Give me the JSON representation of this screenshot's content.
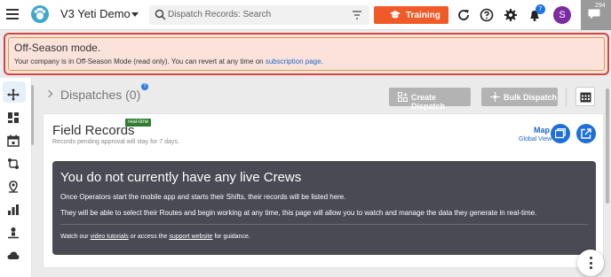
{
  "header": {
    "app_title": "V3 Yeti Demo",
    "search_placeholder": "Dispatch Records: Search",
    "training_label": "Training",
    "notification_count": "7",
    "avatar_initial": "S",
    "chat_count": "294",
    "accent_color": "#f05a28"
  },
  "banner": {
    "title": "Off-Season mode.",
    "text": "Your company is in Off-Season Mode (read only). You can revert at any time on",
    "link_text": "subscription page",
    "suffix": "."
  },
  "dispatches": {
    "title": "Dispatches (0)",
    "create_label": "Create Dispatch",
    "bulk_label": "Bulk Dispatch"
  },
  "field_records": {
    "title": "Field Records",
    "badge": "real-time",
    "subtitle": "Records pending approval will stay for 7 days.",
    "map_label": "Map",
    "map_sub": "Global View"
  },
  "empty_state": {
    "title": "You do not currently have any live Crews",
    "para1": "Once Operators start the mobile app and starts their Shifts, their records will be listed here.",
    "para2": "They will be able to select their Routes and begin working at any time, this page will allow you to watch and manage the data they generate in real-time.",
    "foot_prefix": "Watch our",
    "foot_link1": "video tutorials",
    "foot_mid": "or access the",
    "foot_link2": "support website",
    "foot_suffix": "for guidance."
  },
  "icons": [
    "menu-icon",
    "paw-logo-icon",
    "search-icon",
    "filter-icon",
    "graduation-cap-icon",
    "refresh-icon",
    "help-icon",
    "gear-icon",
    "bell-icon",
    "chat-icon",
    "move-icon",
    "dashboard-icon",
    "calendar-icon",
    "routes-icon",
    "map-pin-icon",
    "chart-icon",
    "operator-icon",
    "cloud-icon",
    "calendar-grid-icon",
    "window-icon",
    "external-link-icon",
    "kebab-icon"
  ]
}
